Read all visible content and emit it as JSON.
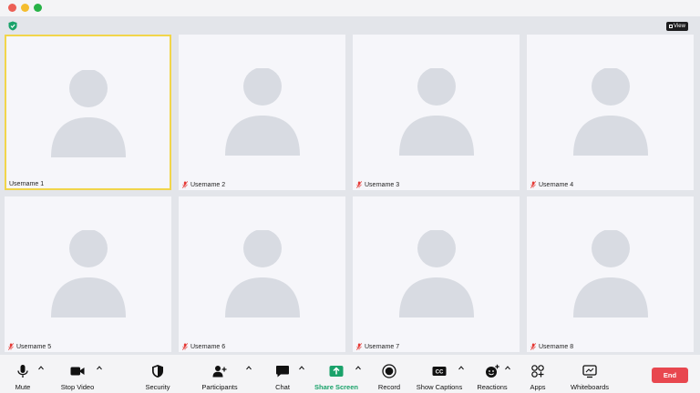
{
  "window": {
    "controls": [
      "close",
      "minimize",
      "maximize"
    ]
  },
  "header": {
    "security_icon": "shield-check-icon",
    "view_label": "View"
  },
  "participants": [
    {
      "name": "Username 1",
      "muted": false,
      "active_speaker": true
    },
    {
      "name": "Username 2",
      "muted": true,
      "active_speaker": false
    },
    {
      "name": "Username 3",
      "muted": true,
      "active_speaker": false
    },
    {
      "name": "Username 4",
      "muted": true,
      "active_speaker": false
    },
    {
      "name": "Username 5",
      "muted": true,
      "active_speaker": false
    },
    {
      "name": "Username 6",
      "muted": true,
      "active_speaker": false
    },
    {
      "name": "Username 7",
      "muted": true,
      "active_speaker": false
    },
    {
      "name": "Username 8",
      "muted": true,
      "active_speaker": false
    }
  ],
  "toolbar": {
    "mute": "Mute",
    "stop_video": "Stop Video",
    "security": "Security",
    "participants": "Participants",
    "chat": "Chat",
    "share_screen": "Share Screen",
    "record": "Record",
    "show_captions": "Show Captions",
    "captions_badge": "CC",
    "reactions": "Reactions",
    "apps": "Apps",
    "whiteboards": "Whiteboards",
    "end": "End"
  },
  "colors": {
    "active_border": "#f1d54a",
    "muted_mic": "#e53935",
    "share_green": "#1aa26a",
    "end_red": "#e8474f"
  }
}
